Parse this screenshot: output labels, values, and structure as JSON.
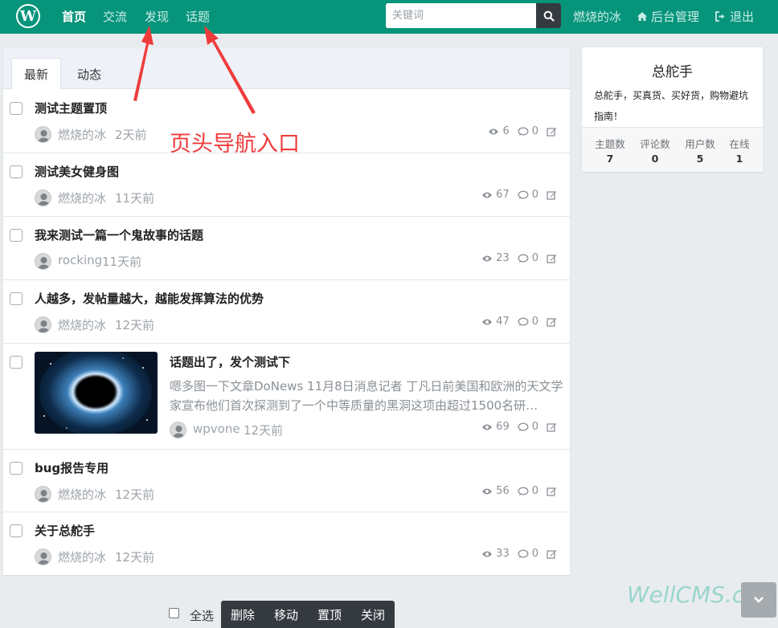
{
  "header": {
    "logo": "W",
    "nav": [
      "首页",
      "交流",
      "发现",
      "话题"
    ],
    "search_placeholder": "关键词",
    "user": "燃烧的冰",
    "admin": "后台管理",
    "logout": "退出"
  },
  "tabs": [
    "最新",
    "动态"
  ],
  "threads": [
    {
      "title": "测试主题置顶",
      "author": "燃烧的冰",
      "time": "2天前",
      "views": "6",
      "comments": "0"
    },
    {
      "title": "测试美女健身图",
      "author": "燃烧的冰",
      "time": "11天前",
      "views": "67",
      "comments": "0"
    },
    {
      "title": "我来测试一篇一个鬼故事的话题",
      "author": "rocking",
      "time": "11天前",
      "views": "23",
      "comments": "0"
    },
    {
      "title": "人越多，发帖量越大，越能发挥算法的优势",
      "author": "燃烧的冰",
      "time": "12天前",
      "views": "47",
      "comments": "0"
    },
    {
      "title": "话题出了，发个测试下",
      "excerpt": "嗯多图一下文章DoNews 11月8日消息记者 丁凡日前美国和欧洲的天文学家宣布他们首次探测到了一个中等质量的黑洞这项由超过1500名研…",
      "author": "wpvone",
      "time": "12天前",
      "views": "69",
      "comments": "0"
    },
    {
      "title": "bug报告专用",
      "author": "燃烧的冰",
      "time": "12天前",
      "views": "56",
      "comments": "0"
    },
    {
      "title": "关于总舵手",
      "author": "燃烧的冰",
      "time": "12天前",
      "views": "33",
      "comments": "0"
    }
  ],
  "annotation": "页头导航入口",
  "sidebar": {
    "title": "总舵手",
    "desc": "总舵手，买真货、买好货，购物避坑指南！",
    "stats": [
      {
        "label": "主题数",
        "value": "7"
      },
      {
        "label": "评论数",
        "value": "0"
      },
      {
        "label": "用户数",
        "value": "5"
      },
      {
        "label": "在线",
        "value": "1"
      }
    ]
  },
  "bottom": {
    "select_all": "全选",
    "buttons": [
      "删除",
      "移动",
      "置顶",
      "关闭"
    ]
  },
  "watermark": "WellCMS.cn",
  "colors": {
    "header": "#06947b",
    "annotation": "#ef3b3b"
  }
}
